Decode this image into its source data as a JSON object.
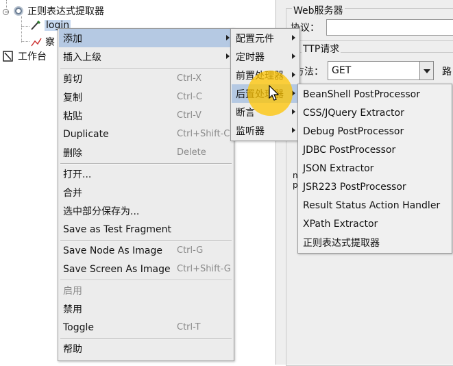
{
  "tree": {
    "root_label": "正则表达式提取器",
    "selected_label": "login",
    "partial_child_label": "察",
    "workbench_label": "工作台"
  },
  "right_panel": {
    "web_server_title": "Web服务器",
    "protocol_label": "协议：",
    "http_request_title": "TTP请求",
    "method_label": "方法：",
    "method_value": "GET",
    "path_label_partial": "路",
    "partial_row1": "n",
    "partial_row2": "p"
  },
  "context_menu": {
    "items": [
      {
        "label": "添加",
        "shortcut": "",
        "submenu": true,
        "highlighted": true
      },
      {
        "label": "插入上级",
        "shortcut": "",
        "submenu": true
      },
      {
        "label": "剪切",
        "shortcut": "Ctrl-X"
      },
      {
        "label": "复制",
        "shortcut": "Ctrl-C"
      },
      {
        "label": "粘贴",
        "shortcut": "Ctrl-V"
      },
      {
        "label": "Duplicate",
        "shortcut": "Ctrl+Shift-C"
      },
      {
        "label": "删除",
        "shortcut": "Delete"
      },
      {
        "label": "打开...",
        "shortcut": ""
      },
      {
        "label": "合并",
        "shortcut": ""
      },
      {
        "label": "选中部分保存为...",
        "shortcut": ""
      },
      {
        "label": "Save as Test Fragment",
        "shortcut": ""
      },
      {
        "label": "Save Node As Image",
        "shortcut": "Ctrl-G"
      },
      {
        "label": "Save Screen As Image",
        "shortcut": "Ctrl+Shift-G"
      },
      {
        "label": "启用",
        "shortcut": "",
        "disabled": true
      },
      {
        "label": "禁用",
        "shortcut": ""
      },
      {
        "label": "Toggle",
        "shortcut": "Ctrl-T"
      },
      {
        "label": "帮助",
        "shortcut": ""
      }
    ]
  },
  "add_submenu": {
    "items": [
      {
        "label": "配置元件"
      },
      {
        "label": "定时器"
      },
      {
        "label": "前置处理器"
      },
      {
        "label": "后置处理器",
        "highlighted": true
      },
      {
        "label": "断言"
      },
      {
        "label": "监听器"
      }
    ]
  },
  "post_processor_submenu": {
    "items": [
      {
        "label": "BeanShell PostProcessor"
      },
      {
        "label": "CSS/JQuery Extractor"
      },
      {
        "label": "Debug PostProcessor"
      },
      {
        "label": "JDBC PostProcessor"
      },
      {
        "label": "JSON Extractor"
      },
      {
        "label": "JSR223 PostProcessor"
      },
      {
        "label": "Result Status Action Handler"
      },
      {
        "label": "XPath Extractor"
      },
      {
        "label": "正则表达式提取器"
      }
    ]
  },
  "colors": {
    "menu_bg": "#ececec",
    "menu_highlight": "#b5c9e3",
    "cursor_highlight": "#ffc400"
  }
}
